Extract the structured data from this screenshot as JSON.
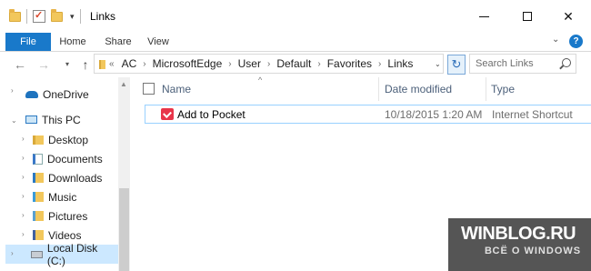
{
  "window": {
    "title": "Links"
  },
  "ribbon": {
    "tabs": [
      "File",
      "Home",
      "Share",
      "View"
    ],
    "help_label": "?"
  },
  "address": {
    "crumbs": [
      "AC",
      "MicrosoftEdge",
      "User",
      "Default",
      "Favorites",
      "Links"
    ],
    "search_placeholder": "Search Links"
  },
  "nav": {
    "items": [
      {
        "label": "OneDrive",
        "icon": "onedrive-icon"
      },
      {
        "label": "This PC",
        "icon": "computer-icon"
      },
      {
        "label": "Desktop",
        "icon": "desktop-folder-icon"
      },
      {
        "label": "Documents",
        "icon": "documents-icon"
      },
      {
        "label": "Downloads",
        "icon": "downloads-icon"
      },
      {
        "label": "Music",
        "icon": "music-icon"
      },
      {
        "label": "Pictures",
        "icon": "pictures-icon"
      },
      {
        "label": "Videos",
        "icon": "videos-icon"
      },
      {
        "label": "Local Disk (C:)",
        "icon": "disk-icon"
      }
    ],
    "selected": "Local Disk (C:)"
  },
  "columns": {
    "name": "Name",
    "date": "Date modified",
    "type": "Type"
  },
  "files": [
    {
      "name": "Add to Pocket",
      "date": "10/18/2015 1:20 AM",
      "type": "Internet Shortcut",
      "icon": "pocket-icon"
    }
  ],
  "watermark": {
    "logo": "WINBLOG.RU",
    "tagline": "ВСЁ О WINDOWS"
  },
  "colors": {
    "accent": "#1979ca",
    "selection": "#cce8ff",
    "folder": "#f2c75c"
  }
}
